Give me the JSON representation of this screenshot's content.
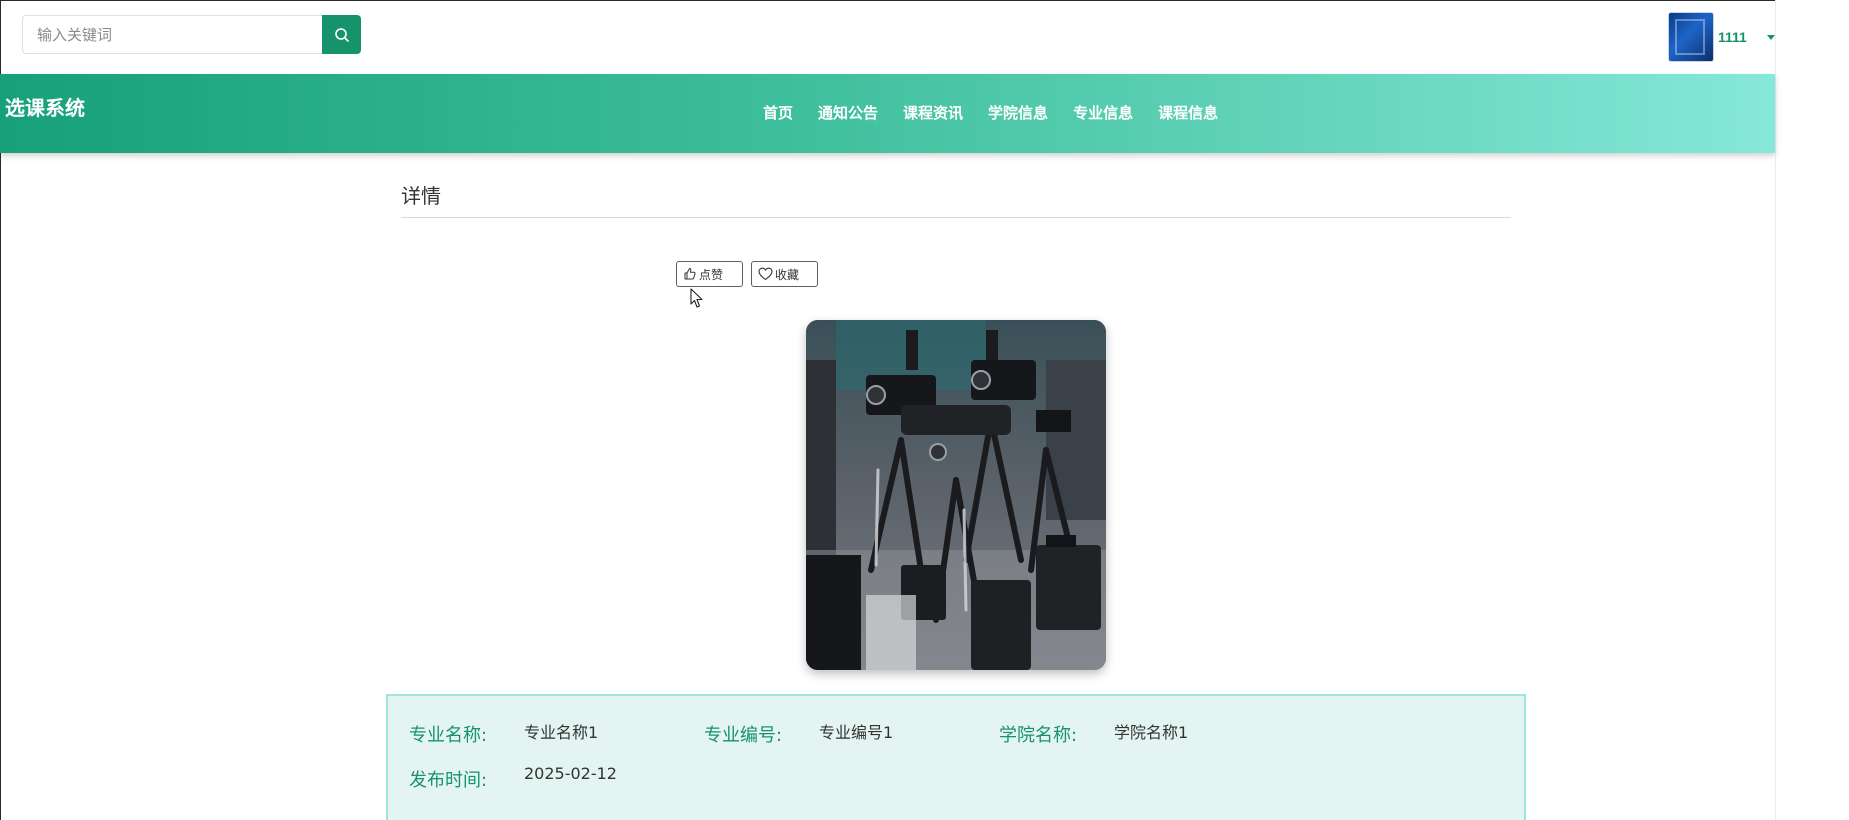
{
  "search": {
    "placeholder": "输入关键词"
  },
  "user": {
    "name": "1111"
  },
  "brand": {
    "title": "选课系统"
  },
  "nav": {
    "items": [
      {
        "label": "首页"
      },
      {
        "label": "通知公告"
      },
      {
        "label": "课程资讯"
      },
      {
        "label": "学院信息"
      },
      {
        "label": "专业信息"
      },
      {
        "label": "课程信息"
      }
    ]
  },
  "detail": {
    "title": "详情",
    "like_label": "点赞",
    "favorite_label": "收藏"
  },
  "info": {
    "major_name_label": "专业名称:",
    "major_name_value": "专业名称1",
    "major_code_label": "专业编号:",
    "major_code_value": "专业编号1",
    "college_name_label": "学院名称:",
    "college_name_value": "学院名称1",
    "publish_time_label": "发布时间:",
    "publish_time_value": "2025-02-12"
  },
  "colors": {
    "accent": "#17936b",
    "nav_gradient_start": "#17a07a",
    "nav_gradient_end": "#86e8d8",
    "panel_background": "#e3f4f1",
    "panel_border": "#9ee6dc"
  },
  "icons": {
    "search_button": "search-icon",
    "like_button": "thumbs-up-icon",
    "favorite_button": "heart-icon",
    "user_menu": "caret-down-icon",
    "pointer": "mouse-cursor-icon"
  }
}
